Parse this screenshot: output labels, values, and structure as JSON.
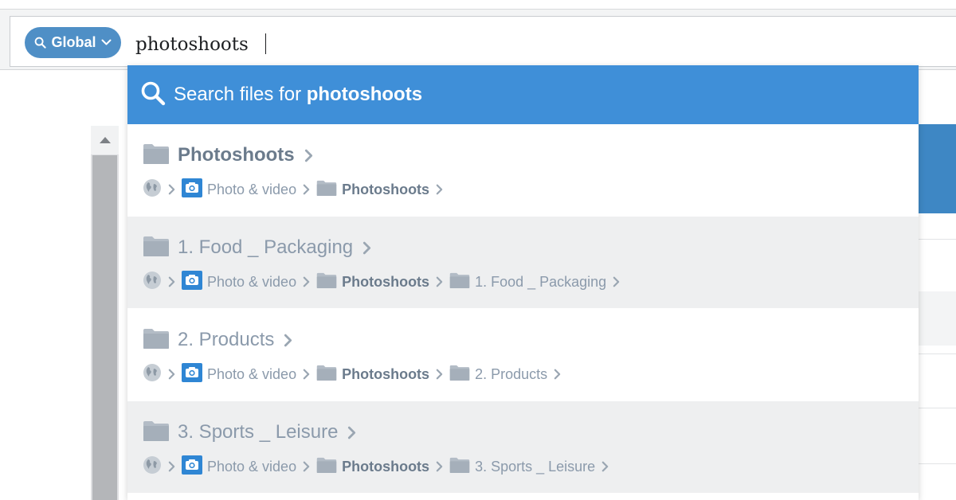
{
  "search": {
    "scope_label": "Global",
    "query": "photoshoots"
  },
  "search_files": {
    "prefix": "Search files for ",
    "query": "photoshoots"
  },
  "results": [
    {
      "title": "Photoshoots",
      "path": [
        "Photo & video",
        "Photoshoots"
      ]
    },
    {
      "title": "1. Food _ Packaging",
      "path": [
        "Photo & video",
        "Photoshoots",
        "1. Food _ Packaging"
      ]
    },
    {
      "title": "2. Products",
      "path": [
        "Photo & video",
        "Photoshoots",
        "2. Products"
      ]
    },
    {
      "title": "3. Sports _ Leisure",
      "path": [
        "Photo & video",
        "Photoshoots",
        "3. Sports _ Leisure"
      ]
    }
  ],
  "icons": {
    "scope": "search-icon",
    "scope_dropdown": "chevron-down-icon",
    "search_files": "search-icon",
    "result": "folder-icon",
    "root": "globe-icon",
    "media": "camera-icon",
    "separator": "chevron-right-icon"
  },
  "colors": {
    "accent": "#3f8fd8",
    "scope_pill": "#4f8fc6",
    "muted_text": "#8b9aab",
    "folder": "#b3bcc6"
  }
}
